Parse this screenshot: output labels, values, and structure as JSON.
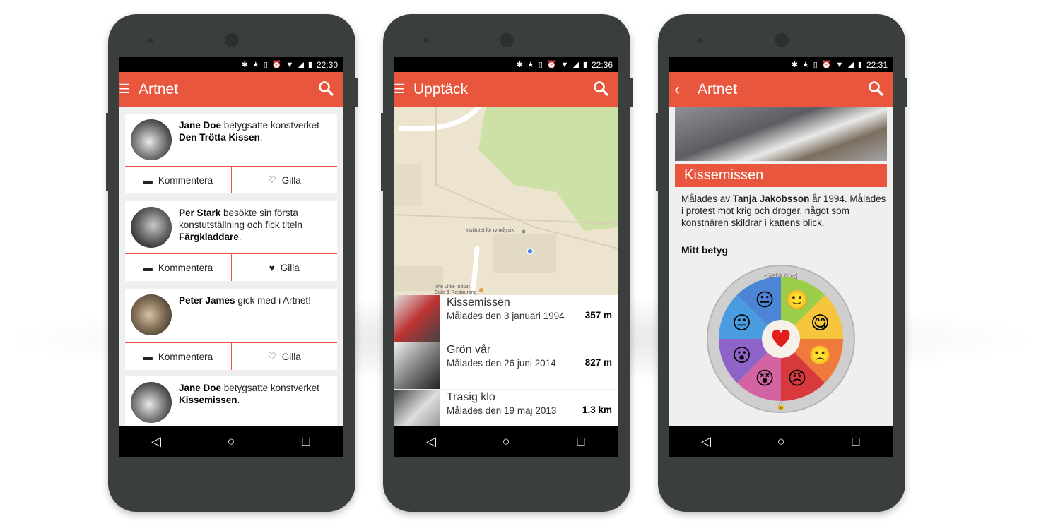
{
  "phones": [
    {
      "status_time": "22:30",
      "app_title": "Artnet",
      "feed": [
        {
          "name": "Jane Doe",
          "text_before": " betygsatte konstverket ",
          "bold_after": "Den Trötta Kissen",
          "trail": ".",
          "comment": "Kommentera",
          "like": "Gilla",
          "liked": false
        },
        {
          "name": "Per Stark",
          "text_before": " besökte sin första konstutställning och fick titeln ",
          "bold_after": "Färgkladdare",
          "trail": ".",
          "comment": "Kommentera",
          "like": "Gilla",
          "liked": true
        },
        {
          "name": "Peter James",
          "text_before": " gick med i Artnet!",
          "bold_after": "",
          "trail": "",
          "comment": "Kommentera",
          "like": "Gilla",
          "liked": false
        },
        {
          "name": "Jane Doe",
          "text_before": " betygsatte konstverket ",
          "bold_after": "Kissemissen",
          "trail": ".",
          "comment": "",
          "like": "",
          "liked": false
        }
      ]
    },
    {
      "status_time": "22:36",
      "app_title": "Upptäck",
      "map_labels": {
        "poi1": "Institutet för rymdfysik",
        "poi2": "The Little Indian",
        "poi3": "Cafe & Restaurang"
      },
      "items": [
        {
          "title": "Kissemissen",
          "sub": "Målades den 3 januari 1994",
          "dist": "357 m"
        },
        {
          "title": "Grön vår",
          "sub": "Målades den 26 juni 2014",
          "dist": "827 m"
        },
        {
          "title": "Trasig klo",
          "sub": "Målades den 19 maj 2013",
          "dist": "1.3 km"
        }
      ]
    },
    {
      "status_time": "22:31",
      "app_title": "Artnet",
      "artwork_title": "Kissemissen",
      "desc_pre": "Målades av ",
      "desc_artist": "Tanja Jakobsson",
      "desc_post": " år 1994. Målades i protest mot krig och droger, något som konstnären skildrar i kattens blick.",
      "rating_heading": "Mitt betyg",
      "wheel_top_label": "nästa nivå"
    }
  ],
  "colors": {
    "accent": "#e9563e",
    "wheel": [
      "#9ccd48",
      "#f5c53b",
      "#f07a3c",
      "#d8393c",
      "#d463a4",
      "#8e64c8",
      "#4a9be0",
      "#4c85d6"
    ]
  }
}
